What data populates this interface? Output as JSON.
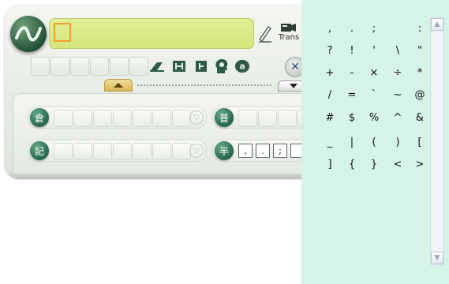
{
  "ime": {
    "trans_label": "Trans",
    "group1_badge": "倉",
    "group2_badge": "普",
    "group3_badge": "記",
    "group4_badge": "半",
    "punct_keys": [
      ",",
      ".",
      ";"
    ]
  },
  "symbols": [
    [
      ",",
      ".",
      ";",
      "",
      ":"
    ],
    [
      "?",
      "!",
      "'",
      "\\",
      "\""
    ],
    [
      "+",
      "-",
      "×",
      "÷",
      "*"
    ],
    [
      "/",
      "=",
      "`",
      "~",
      "@"
    ],
    [
      "#",
      "$",
      "%",
      "^",
      "&"
    ],
    [
      "_",
      "|",
      "(",
      ")",
      "["
    ],
    [
      "]",
      "{",
      "}",
      "<",
      ">"
    ]
  ],
  "scrollbar": {
    "up": "▲",
    "down": "▼"
  }
}
